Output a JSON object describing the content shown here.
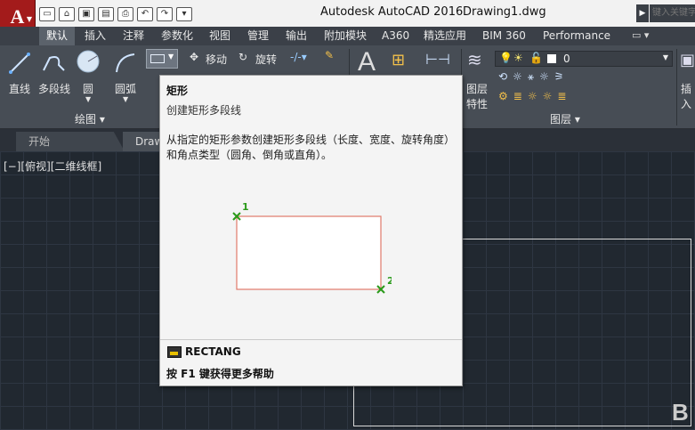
{
  "titlebar": {
    "app_name": "Autodesk AutoCAD 2016",
    "document": "Drawing1.dwg",
    "search_placeholder": "键入关键字"
  },
  "ribbon_tabs": [
    "默认",
    "插入",
    "注释",
    "参数化",
    "视图",
    "管理",
    "输出",
    "附加模块",
    "A360",
    "精选应用",
    "BIM 360",
    "Performance"
  ],
  "ribbon": {
    "draw_tools": [
      "直线",
      "多段线",
      "圆",
      "圆弧"
    ],
    "draw_panel_title": "绘图 ▾",
    "modify_tools": [
      "移动",
      "旋转"
    ],
    "layer_panel_title": "图层 ▾",
    "layer_tools": [
      "图层",
      "特性"
    ],
    "layer_value": "0",
    "insert_tool": "插入"
  },
  "file_tabs": [
    "开始",
    "Draw"
  ],
  "viewport_label": "[−][俯视][二维线框]",
  "tooltip": {
    "title": "矩形",
    "subtitle": "创建矩形多段线",
    "description": "从指定的矩形参数创建矩形多段线（长度、宽度、旋转角度）和角点类型（圆角、倒角或直角）。",
    "point1": "1",
    "point2": "2",
    "command": "RECTANG",
    "help": "按 F1 键获得更多帮助"
  },
  "colors": {
    "app_red": "#a31b1b",
    "ribbon_bg": "#474d55",
    "canvas_bg": "#212830",
    "tooltip_bg": "#f4f4f4",
    "rect_stroke": "#e07a6a",
    "point_green": "#2a9a1a"
  },
  "corner_logo": "B"
}
